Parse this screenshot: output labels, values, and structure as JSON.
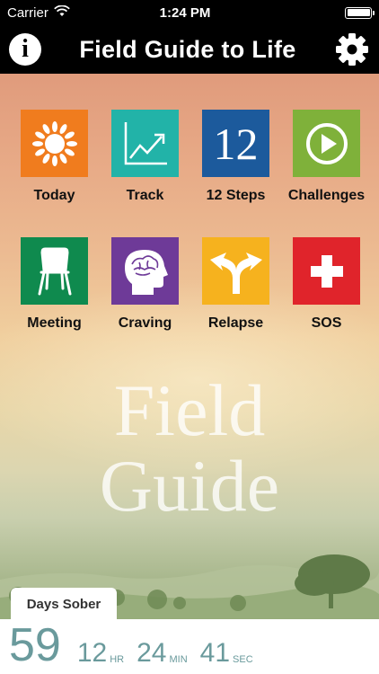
{
  "status_bar": {
    "carrier": "Carrier",
    "time": "1:24 PM"
  },
  "nav": {
    "title": "Field Guide to Life",
    "info_icon": "info-icon",
    "settings_icon": "gear-icon"
  },
  "tiles": [
    {
      "label": "Today",
      "icon": "sun-icon",
      "color": "#f07c1e"
    },
    {
      "label": "Track",
      "icon": "chart-icon",
      "color": "#22b3a8"
    },
    {
      "label": "12 Steps",
      "icon": "twelve-icon",
      "icon_text": "12",
      "color": "#1c5a9c"
    },
    {
      "label": "Challenges",
      "icon": "play-icon",
      "color": "#7fb13a"
    },
    {
      "label": "Meeting",
      "icon": "chair-icon",
      "color": "#0f8a4e"
    },
    {
      "label": "Craving",
      "icon": "brain-icon",
      "color": "#6e3a98"
    },
    {
      "label": "Relapse",
      "icon": "split-arrow-icon",
      "color": "#f6b21e"
    },
    {
      "label": "SOS",
      "icon": "plus-icon",
      "color": "#e0242b"
    }
  ],
  "background_text": {
    "line1": "Field",
    "line2": "Guide"
  },
  "counter": {
    "tab_label": "Days Sober",
    "days": "59",
    "hours": "12",
    "hours_unit": "HR",
    "minutes": "24",
    "minutes_unit": "MIN",
    "seconds": "41",
    "seconds_unit": "SEC",
    "color": "#6a9a9c"
  }
}
